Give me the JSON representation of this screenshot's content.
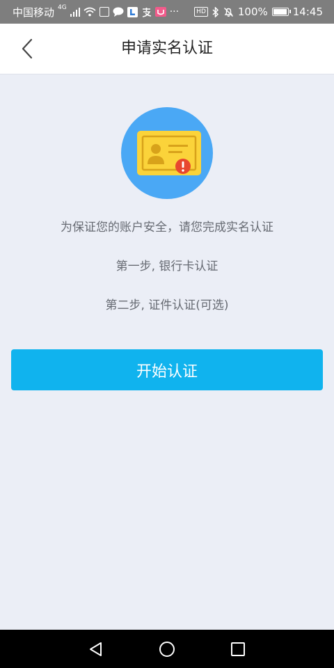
{
  "status_bar": {
    "carrier": "中国移动",
    "network": "4G",
    "battery": "100%",
    "battery_level": 1.0,
    "time": "14:45",
    "hd_label": "HD",
    "more": "···"
  },
  "header": {
    "title": "申请实名认证"
  },
  "content": {
    "line1": "为保证您的账户安全，请您完成实名认证",
    "line2": "第一步, 银行卡认证",
    "line3": "第二步, 证件认证(可选)"
  },
  "action": {
    "start_label": "开始认证"
  },
  "colors": {
    "accent": "#10b3ee",
    "badge_circle": "#4aa8f5",
    "card_yellow": "#fbd33a",
    "warning_red": "#e8472f",
    "background": "#ebeef6"
  },
  "icons": {
    "back": "chevron-left-icon",
    "badge": "id-card-warning-icon",
    "nav_back": "triangle-back-icon",
    "nav_home": "circle-home-icon",
    "nav_recent": "square-recent-icon"
  }
}
